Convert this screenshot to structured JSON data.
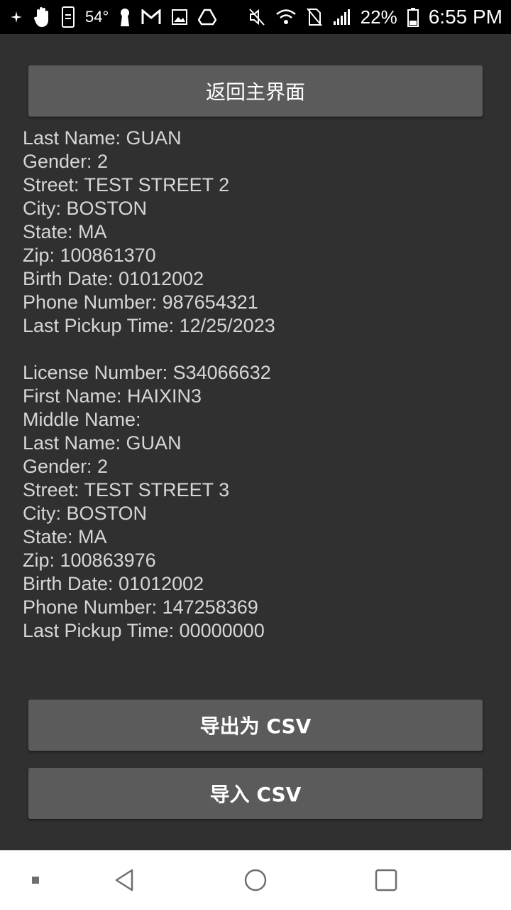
{
  "status_bar": {
    "temperature": "54°",
    "battery_percent": "22%",
    "time": "6:55 PM",
    "icons_left": [
      "tracking-icon",
      "hand-icon",
      "phone-sync-icon",
      "temperature-label",
      "keyhole-icon",
      "gmail-icon",
      "gallery-icon",
      "drive-icon"
    ],
    "icons_right": [
      "mute-icon",
      "wifi-icon",
      "no-sim-icon",
      "signal-icon",
      "battery-icon"
    ]
  },
  "buttons": {
    "back": "返回主界面",
    "export": "导出为 CSV",
    "import": "导入 CSV"
  },
  "records": [
    {
      "lines": [
        "Last Name: GUAN",
        "Gender: 2",
        "Street: TEST STREET 2",
        "City: BOSTON",
        "State: MA",
        "Zip: 100861370",
        "Birth Date: 01012002",
        "Phone Number: 987654321",
        "Last Pickup Time: 12/25/2023"
      ]
    },
    {
      "lines": [
        "License Number: S34066632",
        "First Name: HAIXIN3",
        "Middle Name:",
        "Last Name: GUAN",
        "Gender: 2",
        "Street: TEST STREET 3",
        "City: BOSTON",
        "State: MA",
        "Zip: 100863976",
        "Birth Date: 01012002",
        "Phone Number: 147258369",
        "Last Pickup Time: 00000000"
      ]
    }
  ],
  "nav_bar": {
    "items": [
      "dot-icon",
      "back-icon",
      "home-icon",
      "recents-icon"
    ]
  },
  "colors": {
    "background": "#303030",
    "button": "#5b5b5c",
    "text": "#d6d6d6",
    "status_bar": "#000000",
    "nav_bar": "#ffffff"
  }
}
